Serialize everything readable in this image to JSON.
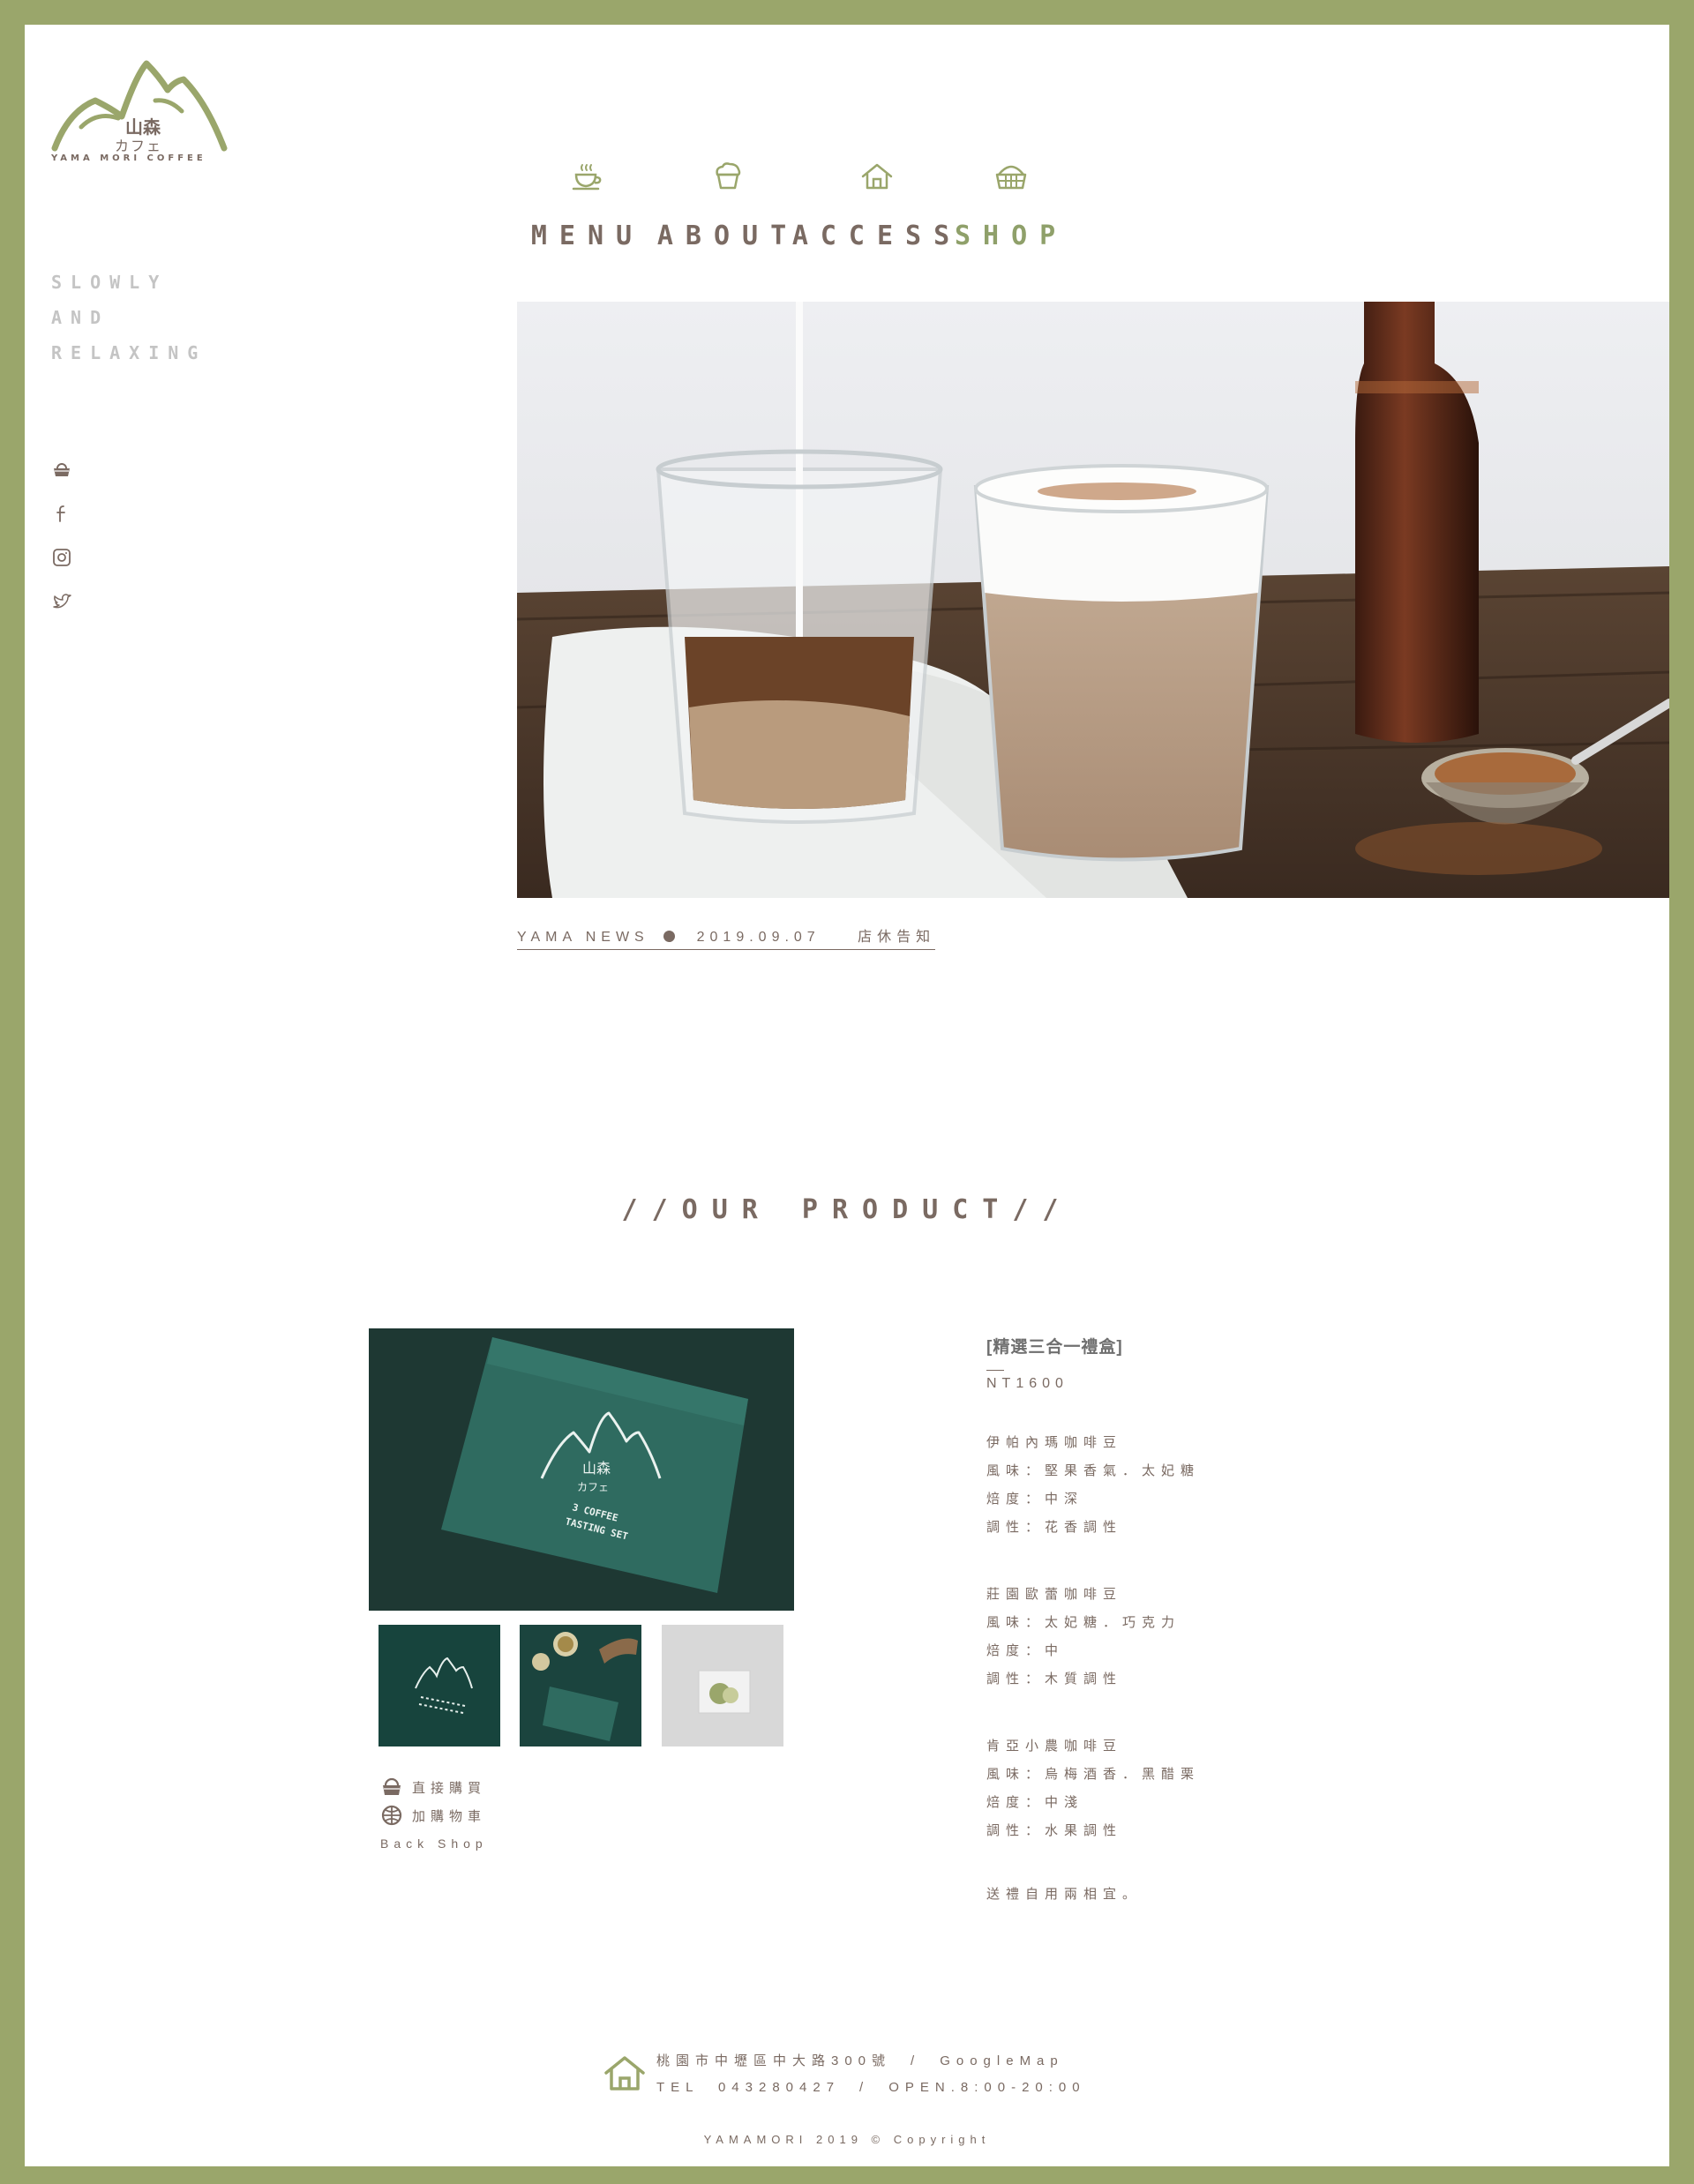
{
  "brand": {
    "logo_jp_line1": "山森",
    "logo_jp_line2": "カフェ",
    "logo_en": "YAMA MORI COFFEE",
    "tagline": [
      "SLOWLY",
      "AND",
      "RELAXING"
    ],
    "accent_color": "#9aa66b"
  },
  "nav": {
    "items": [
      {
        "label": "MENU",
        "icon": "coffee-cup-icon"
      },
      {
        "label": "ABOUT",
        "icon": "cupcake-icon"
      },
      {
        "label": "ACCESS",
        "icon": "house-icon"
      },
      {
        "label": "SHOP",
        "icon": "basket-icon",
        "active": true
      }
    ]
  },
  "social": [
    "basket-icon",
    "facebook-icon",
    "instagram-icon",
    "twitter-icon"
  ],
  "news": {
    "label": "YAMA NEWS",
    "date": "2019.09.07",
    "title": "店休告知"
  },
  "section_title": "//OUR PRODUCT//",
  "product": {
    "name": "[精選三合一禮盒]",
    "price": "NT1600",
    "beans": [
      {
        "name": "伊帕內瑪咖啡豆",
        "flavor": "風味：堅果香氣．太妃糖",
        "roast": "焙度：中深",
        "character": "調性：花香調性"
      },
      {
        "name": "莊園歐蕾咖啡豆",
        "flavor": "風味：太妃糖．巧克力",
        "roast": "焙度：中",
        "character": "調性：木質調性"
      },
      {
        "name": "肯亞小農咖啡豆",
        "flavor": "風味：烏梅酒香．黑醋栗",
        "roast": "焙度：中淺",
        "character": "調性：水果調性"
      }
    ],
    "closing": "送禮自用兩相宜。",
    "actions": {
      "buy_now": "直接購買",
      "add_cart": "加購物車",
      "back_shop": "Back Shop"
    },
    "box_text_line1": "山森",
    "box_text_line2": "カフェ",
    "box_text_line3": "3 COFFEE",
    "box_text_line4": "TASTING SET"
  },
  "footer": {
    "address": "桃園市中壢區中大路300號　/　GoogleMap",
    "contact": "TEL　043280427　/　OPEN.8:00-20:00",
    "copyright": "YAMAMORI 2019 © Copyright"
  }
}
